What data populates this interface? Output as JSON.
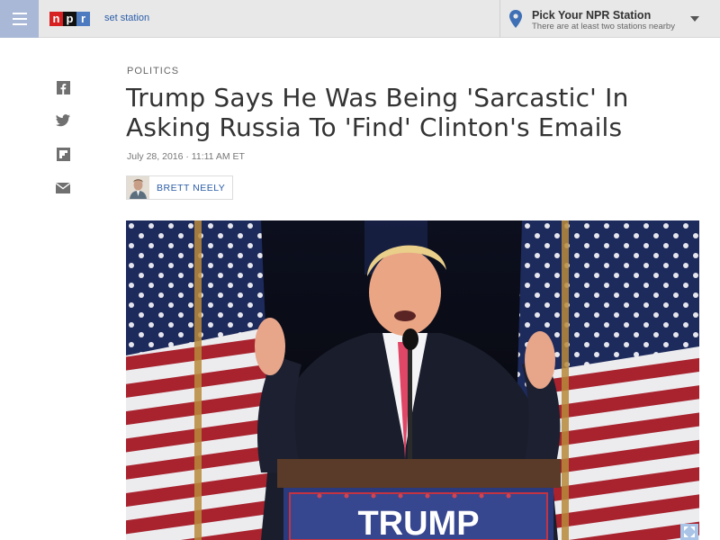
{
  "header": {
    "logo_letters": [
      "n",
      "p",
      "r"
    ],
    "logo_colors": [
      "#d62021",
      "#111111",
      "#4e7bc0"
    ],
    "set_station_label": "set station",
    "station_title": "Pick Your NPR Station",
    "station_subtitle": "There are at least two stations nearby",
    "icons": [
      "menu-icon",
      "location-pin-icon",
      "caret-down-icon"
    ]
  },
  "share": {
    "items": [
      "facebook-icon",
      "twitter-icon",
      "flipboard-icon",
      "email-icon"
    ]
  },
  "article": {
    "slug": "Politics",
    "headline": "Trump Says He Was Being 'Sarcastic' In Asking Russia To 'Find' Clinton's Emails",
    "dateline": "July 28, 2016 · 11:11 AM ET",
    "author": "Brett Neely"
  },
  "photo": {
    "podium_sign": "TRUMP",
    "icons": [
      "enlarge-icon"
    ]
  }
}
